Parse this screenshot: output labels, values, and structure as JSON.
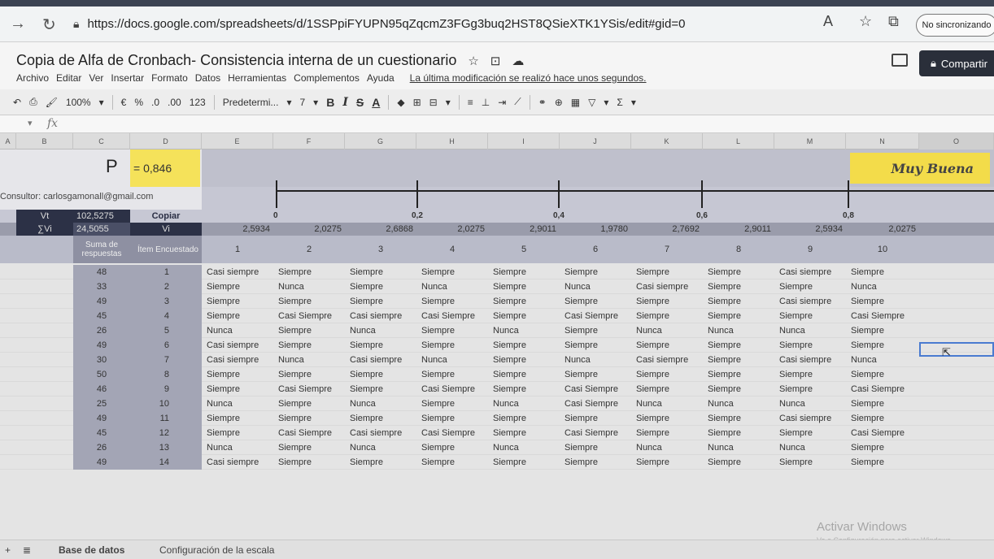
{
  "browser": {
    "url": "https://docs.google.com/spreadsheets/d/1SSPpiFYUPN95qZqcmZ3FGg3buq2HST8QSieXTK1YSis/edit#gid=0",
    "sync_label": "No sincronizando"
  },
  "doc": {
    "title": "Copia de Alfa de Cronbach- Consistencia interna de un cuestionario",
    "menus": [
      "Archivo",
      "Editar",
      "Ver",
      "Insertar",
      "Formato",
      "Datos",
      "Herramientas",
      "Complementos",
      "Ayuda"
    ],
    "last_edit": "La última modificación se realizó hace unos segundos.",
    "share_label": "Compartir"
  },
  "toolbar": {
    "zoom": "100%",
    "currency": "€",
    "percent": "%",
    "dec_less": ".0",
    "dec_more": ".00",
    "format_123": "123",
    "font": "Predetermi...",
    "size": "7",
    "bold": "B",
    "italic": "I",
    "strike": "S",
    "text_color": "A"
  },
  "formula_bar": {
    "fx": "fx"
  },
  "columns": [
    "A",
    "B",
    "C",
    "D",
    "E",
    "F",
    "G",
    "H",
    "I",
    "J",
    "K",
    "L",
    "M",
    "N",
    "O"
  ],
  "sheet": {
    "p_label": "P",
    "p_value": "= 0,846",
    "quality": "Muy Buena",
    "consultor": "Consultor: carlosgamonall@gmail.com",
    "scale_labels": [
      "0",
      "0,2",
      "0,4",
      "0,6",
      "0,8"
    ],
    "vt_label": "Vt",
    "vt_value": "102,5275",
    "copiar": "Copiar",
    "svi_label": "∑Vi",
    "svi_value": "24,5055",
    "vi_label": "Vi",
    "vi_values": [
      "2,5934",
      "2,0275",
      "2,6868",
      "2,0275",
      "2,9011",
      "1,9780",
      "2,7692",
      "2,9011",
      "2,5934",
      "2,0275"
    ],
    "sum_header": "Suma de respuestas",
    "item_header": "Ítem Encuestado",
    "item_numbers": [
      "1",
      "2",
      "3",
      "4",
      "5",
      "6",
      "7",
      "8",
      "9",
      "10"
    ]
  },
  "rows": [
    {
      "sum": "48",
      "idx": "1",
      "answers": [
        "Casi siempre",
        "Siempre",
        "Siempre",
        "Siempre",
        "Siempre",
        "Siempre",
        "Siempre",
        "Siempre",
        "Casi siempre",
        "Siempre"
      ]
    },
    {
      "sum": "33",
      "idx": "2",
      "answers": [
        "Siempre",
        "Nunca",
        "Siempre",
        "Nunca",
        "Siempre",
        "Nunca",
        "Casi siempre",
        "Siempre",
        "Siempre",
        "Nunca"
      ]
    },
    {
      "sum": "49",
      "idx": "3",
      "answers": [
        "Siempre",
        "Siempre",
        "Siempre",
        "Siempre",
        "Siempre",
        "Siempre",
        "Siempre",
        "Siempre",
        "Casi siempre",
        "Siempre"
      ]
    },
    {
      "sum": "45",
      "idx": "4",
      "answers": [
        "Siempre",
        "Casi Siempre",
        "Casi siempre",
        "Casi Siempre",
        "Siempre",
        "Casi Siempre",
        "Siempre",
        "Siempre",
        "Siempre",
        "Casi Siempre"
      ]
    },
    {
      "sum": "26",
      "idx": "5",
      "answers": [
        "Nunca",
        "Siempre",
        "Nunca",
        "Siempre",
        "Nunca",
        "Siempre",
        "Nunca",
        "Nunca",
        "Nunca",
        "Siempre"
      ]
    },
    {
      "sum": "49",
      "idx": "6",
      "answers": [
        "Casi siempre",
        "Siempre",
        "Siempre",
        "Siempre",
        "Siempre",
        "Siempre",
        "Siempre",
        "Siempre",
        "Siempre",
        "Siempre"
      ]
    },
    {
      "sum": "30",
      "idx": "7",
      "answers": [
        "Casi siempre",
        "Nunca",
        "Casi siempre",
        "Nunca",
        "Siempre",
        "Nunca",
        "Casi siempre",
        "Siempre",
        "Casi siempre",
        "Nunca"
      ]
    },
    {
      "sum": "50",
      "idx": "8",
      "answers": [
        "Siempre",
        "Siempre",
        "Siempre",
        "Siempre",
        "Siempre",
        "Siempre",
        "Siempre",
        "Siempre",
        "Siempre",
        "Siempre"
      ]
    },
    {
      "sum": "46",
      "idx": "9",
      "answers": [
        "Siempre",
        "Casi Siempre",
        "Siempre",
        "Casi Siempre",
        "Siempre",
        "Casi Siempre",
        "Siempre",
        "Siempre",
        "Siempre",
        "Casi Siempre"
      ]
    },
    {
      "sum": "25",
      "idx": "10",
      "answers": [
        "Nunca",
        "Siempre",
        "Nunca",
        "Siempre",
        "Nunca",
        "Casi Siempre",
        "Nunca",
        "Nunca",
        "Nunca",
        "Siempre"
      ]
    },
    {
      "sum": "49",
      "idx": "11",
      "answers": [
        "Siempre",
        "Siempre",
        "Siempre",
        "Siempre",
        "Siempre",
        "Siempre",
        "Siempre",
        "Siempre",
        "Casi siempre",
        "Siempre"
      ]
    },
    {
      "sum": "45",
      "idx": "12",
      "answers": [
        "Siempre",
        "Casi Siempre",
        "Casi siempre",
        "Casi Siempre",
        "Siempre",
        "Casi Siempre",
        "Siempre",
        "Siempre",
        "Siempre",
        "Casi Siempre"
      ]
    },
    {
      "sum": "26",
      "idx": "13",
      "answers": [
        "Nunca",
        "Siempre",
        "Nunca",
        "Siempre",
        "Nunca",
        "Siempre",
        "Nunca",
        "Nunca",
        "Nunca",
        "Siempre"
      ]
    },
    {
      "sum": "49",
      "idx": "14",
      "answers": [
        "Casi siempre",
        "Siempre",
        "Siempre",
        "Siempre",
        "Siempre",
        "Siempre",
        "Siempre",
        "Siempre",
        "Siempre",
        "Siempre"
      ]
    }
  ],
  "sheet_tabs": [
    "Base de datos",
    "Configuración de la escala"
  ],
  "watermark": {
    "title": "Activar Windows",
    "subtitle": "Ve a Configuración para activar Windows."
  }
}
